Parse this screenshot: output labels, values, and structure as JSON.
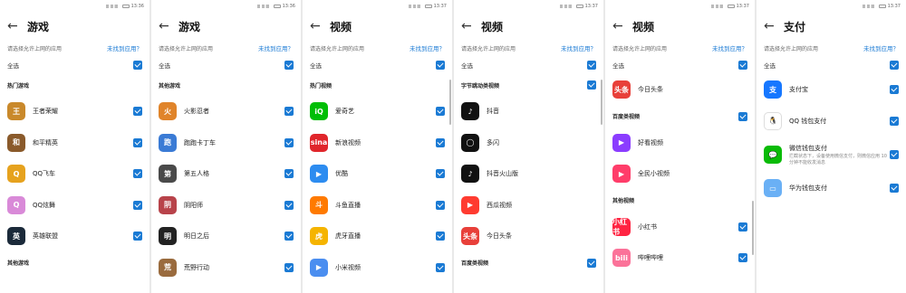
{
  "prompt": "请选择允许上网的应用",
  "link": "未找到应用？",
  "select_all": "全选",
  "screens": [
    {
      "time": "13:36",
      "title": "游戏",
      "items": [
        {
          "type": "section",
          "label": "热门游戏"
        },
        {
          "type": "app",
          "name": "王者荣耀",
          "icon": "honor-of-kings-icon",
          "color": "#c9892b",
          "checked": true
        },
        {
          "type": "app",
          "name": "和平精英",
          "icon": "peacekeeper-elite-icon",
          "color": "#8a5a2b",
          "checked": true
        },
        {
          "type": "app",
          "name": "QQ飞车",
          "icon": "qq-speed-icon",
          "color": "#e6a21e",
          "checked": true
        },
        {
          "type": "app",
          "name": "QQ炫舞",
          "icon": "qq-dance-icon",
          "color": "#d98ad8",
          "checked": true
        },
        {
          "type": "app",
          "name": "英雄联盟",
          "icon": "league-of-legends-icon",
          "color": "#1b2a3a",
          "checked": true
        },
        {
          "type": "section",
          "label": "其他游戏"
        }
      ]
    },
    {
      "time": "13:36",
      "title": "游戏",
      "items": [
        {
          "type": "section",
          "label": "其他游戏"
        },
        {
          "type": "app",
          "name": "火影忍者",
          "icon": "naruto-icon",
          "color": "#e0842a",
          "checked": true
        },
        {
          "type": "app",
          "name": "跑跑卡丁车",
          "icon": "kartrider-icon",
          "color": "#3a7bd5",
          "checked": true
        },
        {
          "type": "app",
          "name": "第五人格",
          "icon": "identity-v-icon",
          "color": "#4a4a4a",
          "checked": true
        },
        {
          "type": "app",
          "name": "阴阳师",
          "icon": "onmyoji-icon",
          "color": "#b8434a",
          "checked": true
        },
        {
          "type": "app",
          "name": "明日之后",
          "icon": "lifeafter-icon",
          "color": "#222222",
          "checked": true
        },
        {
          "type": "app",
          "name": "荒野行动",
          "icon": "knives-out-icon",
          "color": "#9a6b3e",
          "checked": true
        }
      ]
    },
    {
      "time": "13:37",
      "title": "视频",
      "items": [
        {
          "type": "section",
          "label": "热门视频"
        },
        {
          "type": "app",
          "name": "爱奇艺",
          "icon": "iqiyi-icon",
          "color": "#00be06",
          "glyph": "iQ",
          "checked": true
        },
        {
          "type": "app",
          "name": "新浪视频",
          "icon": "sina-video-icon",
          "color": "#e0262b",
          "glyph": "sina",
          "checked": true
        },
        {
          "type": "app",
          "name": "优酷",
          "icon": "youku-icon",
          "color": "#2d8cf0",
          "glyph": "▶",
          "checked": true
        },
        {
          "type": "app",
          "name": "斗鱼直播",
          "icon": "douyu-icon",
          "color": "#ff7a00",
          "checked": true
        },
        {
          "type": "app",
          "name": "虎牙直播",
          "icon": "huya-icon",
          "color": "#f5b400",
          "checked": true
        },
        {
          "type": "app",
          "name": "小米视频",
          "icon": "mi-video-icon",
          "color": "#4b8ef0",
          "glyph": "▶",
          "checked": true
        }
      ]
    },
    {
      "time": "13:37",
      "title": "视频",
      "items": [
        {
          "type": "section",
          "label": "字节跳动类视频",
          "checked": true
        },
        {
          "type": "app",
          "name": "抖音",
          "icon": "douyin-icon",
          "color": "#111111",
          "glyph": "♪",
          "checked": false
        },
        {
          "type": "app",
          "name": "多闪",
          "icon": "duoshan-icon",
          "color": "#111111",
          "glyph": "◯",
          "checked": false
        },
        {
          "type": "app",
          "name": "抖音火山版",
          "icon": "douyin-huoshan-icon",
          "color": "#111111",
          "glyph": "♪",
          "checked": false
        },
        {
          "type": "app",
          "name": "西瓜视频",
          "icon": "xigua-icon",
          "color": "#ff3b30",
          "glyph": "▶",
          "checked": false
        },
        {
          "type": "app",
          "name": "今日头条",
          "icon": "toutiao-icon",
          "color": "#e8403a",
          "glyph": "头条",
          "checked": false
        },
        {
          "type": "section",
          "label": "百度类视频",
          "checked": true
        }
      ]
    },
    {
      "time": "13:37",
      "title": "视频",
      "items": [
        {
          "type": "app",
          "name": "今日头条",
          "icon": "toutiao-icon",
          "color": "#e8403a",
          "glyph": "头条",
          "checked": false
        },
        {
          "type": "section",
          "label": "百度类视频",
          "checked": true
        },
        {
          "type": "app",
          "name": "好看视频",
          "icon": "haokan-icon",
          "color": "#8b3dff",
          "glyph": "▶",
          "checked": false
        },
        {
          "type": "app",
          "name": "全民小视频",
          "icon": "quanmin-icon",
          "color": "#ff3d6a",
          "glyph": "▶",
          "checked": false
        },
        {
          "type": "section",
          "label": "其他视频"
        },
        {
          "type": "app",
          "name": "小红书",
          "icon": "xiaohongshu-icon",
          "color": "#ff2442",
          "glyph": "小红书",
          "checked": true
        },
        {
          "type": "app",
          "name": "哔哩哔哩",
          "icon": "bilibili-icon",
          "color": "#fb7299",
          "glyph": "bili",
          "checked": true
        }
      ]
    },
    {
      "time": "13:37",
      "title": "支付",
      "items": [
        {
          "type": "app",
          "name": "支付宝",
          "icon": "alipay-icon",
          "color": "#1677ff",
          "glyph": "支",
          "checked": true
        },
        {
          "type": "app",
          "name": "QQ 钱包支付",
          "icon": "qq-wallet-icon",
          "color": "#ffffff",
          "glyph": "🐧",
          "checked": true
        },
        {
          "type": "app",
          "name": "微信钱包支付",
          "note": "拦截状态下，设备使用微信支付，则微信应用 10 分钟不能收发消息",
          "icon": "wechat-pay-icon",
          "color": "#09bb07",
          "glyph": "💬",
          "checked": true
        },
        {
          "type": "app",
          "name": "华为钱包支付",
          "icon": "huawei-wallet-icon",
          "color": "#6ab0f5",
          "glyph": "▭",
          "checked": true
        }
      ]
    }
  ]
}
